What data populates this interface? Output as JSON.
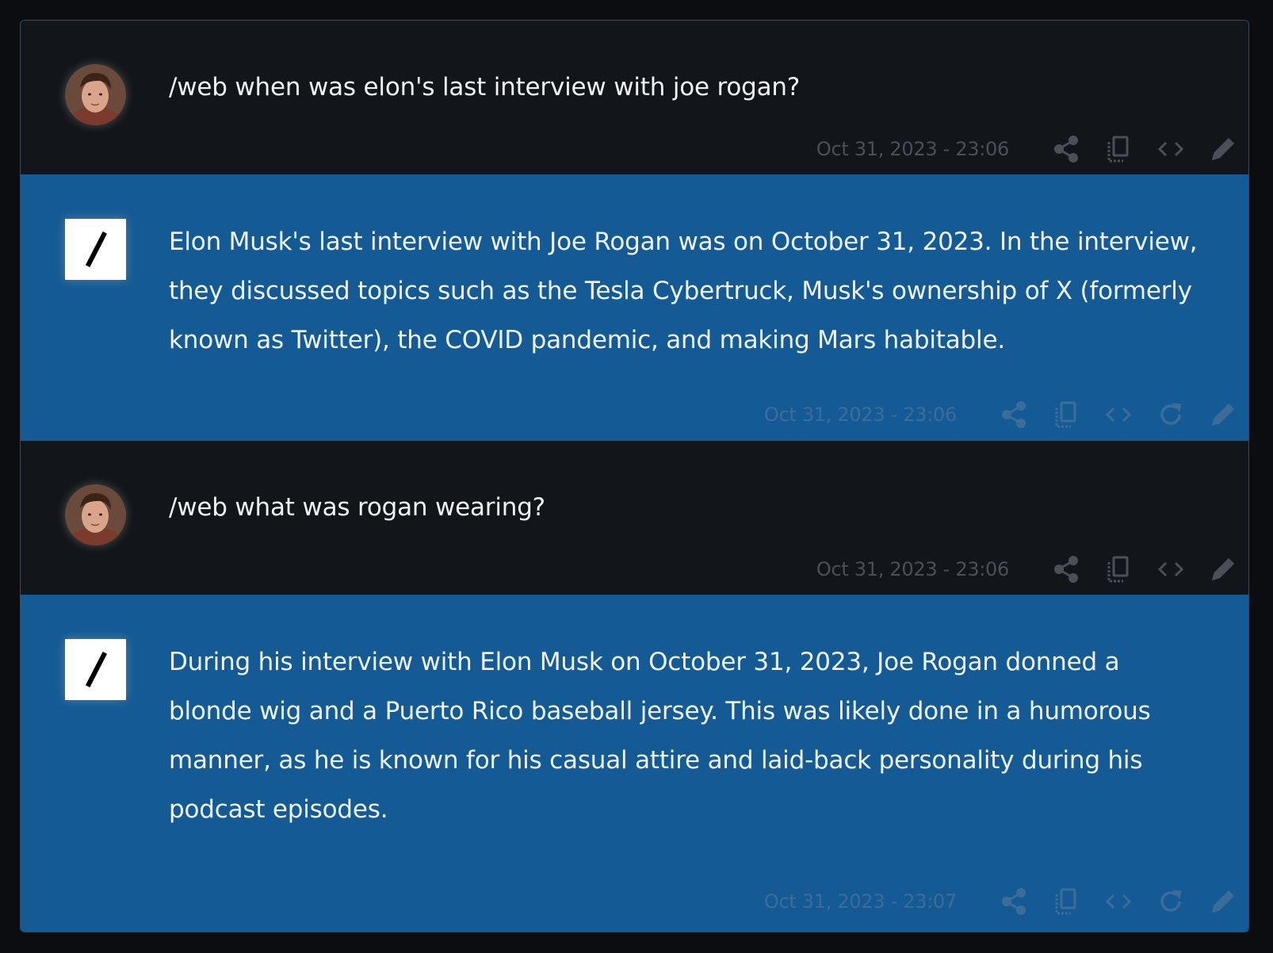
{
  "messages": [
    {
      "role": "user",
      "text": "/web when was elon's last interview with joe rogan?",
      "timestamp": "Oct 31, 2023 - 23:06",
      "actions": [
        "share-icon",
        "copy-icon",
        "code-icon",
        "edit-icon"
      ]
    },
    {
      "role": "assistant",
      "text": "Elon Musk's last interview with Joe Rogan was on October 31, 2023. In the interview, they discussed topics such as the Tesla Cybertruck, Musk's ownership of X (formerly known as Twitter), the COVID pandemic, and making Mars habitable.",
      "timestamp": "Oct 31, 2023 - 23:06",
      "actions": [
        "share-icon",
        "copy-icon",
        "code-icon",
        "regenerate-icon",
        "edit-icon"
      ]
    },
    {
      "role": "user",
      "text": "/web what was rogan wearing?",
      "timestamp": "Oct 31, 2023 - 23:06",
      "actions": [
        "share-icon",
        "copy-icon",
        "code-icon",
        "edit-icon"
      ]
    },
    {
      "role": "assistant",
      "text": "During his interview with Elon Musk on October 31, 2023, Joe Rogan donned a blonde wig and a Puerto Rico baseball jersey. This was likely done in a humorous manner, as he is known for his casual attire and laid-back personality during his podcast episodes.",
      "timestamp": "Oct 31, 2023 - 23:07",
      "actions": [
        "share-icon",
        "copy-icon",
        "code-icon",
        "regenerate-icon",
        "edit-icon"
      ]
    }
  ],
  "colors": {
    "user_bg": "#121519",
    "assistant_bg": "#145a94",
    "text": "#eef3f8",
    "muted_user": "#4b5058",
    "muted_assistant": "#3c6d99"
  }
}
